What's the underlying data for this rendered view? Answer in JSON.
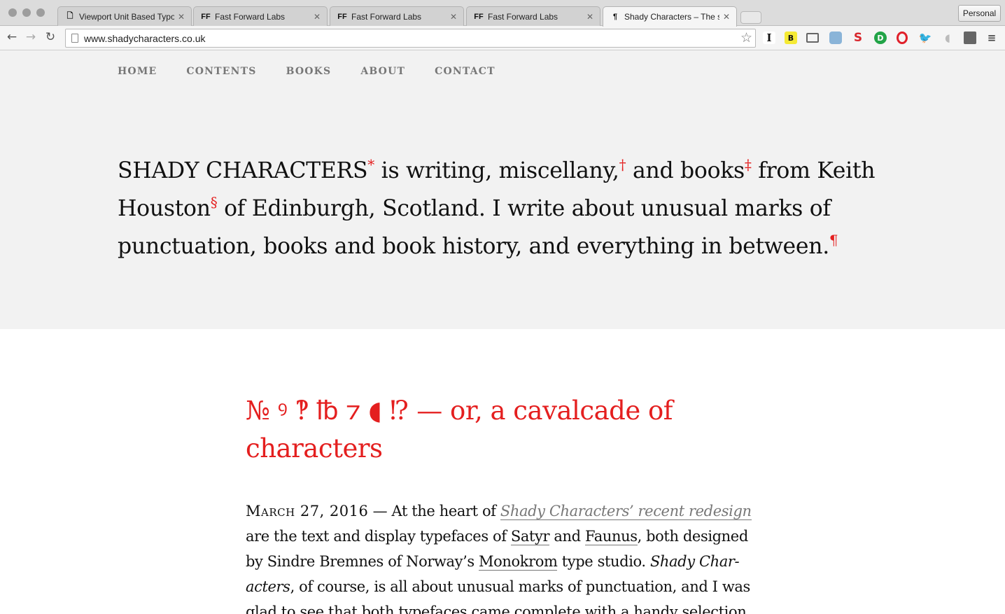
{
  "browser": {
    "tabs": [
      {
        "title": "Viewport Unit Based Typography",
        "icon": "page-icon"
      },
      {
        "title": "Fast Forward Labs",
        "icon": "ff-icon"
      },
      {
        "title": "Fast Forward Labs",
        "icon": "ff-icon"
      },
      {
        "title": "Fast Forward Labs",
        "icon": "ff-icon"
      },
      {
        "title": "Shady Characters – The secret life of punctuation",
        "icon": "pilcrow-icon",
        "active": true
      }
    ],
    "profile_label": "Personal",
    "url": "www.shadycharacters.co.uk",
    "extensions": [
      "instapaper-icon",
      "b-icon",
      "cast-icon",
      "camera-icon",
      "s-icon",
      "d-icon",
      "opera-icon",
      "bird-icon",
      "leaf-icon",
      "puzzle-icon",
      "menu-icon"
    ]
  },
  "site": {
    "nav": [
      "HOME",
      "CONTENTS",
      "BOOKS",
      "ABOUT",
      "CONTACT"
    ],
    "tagline": {
      "part1": "SHADY CHARACTERS",
      "mark1": "*",
      "part2": " is writing, miscellany,",
      "mark2": "†",
      "part3": " and books",
      "mark3": "‡",
      "part4": " from Keith Houston",
      "mark4": "§",
      "part5": " of Edinburgh, Scotland. I write about unusual marks of punc­tuation, books and book history, and everything in between.",
      "mark5": "¶"
    },
    "accent_color": "#e41f1f"
  },
  "post": {
    "title": "№ ꝰ ‽ ℔ ⁊ ◖ ⁉ — or, a cavalcade of characters",
    "date": "March 27, 2016",
    "sep": " — At the heart of ",
    "link1": "Shady Characters’ recent redesign",
    "t1": " are the text and display typefaces of ",
    "link2": "Satyr",
    "t2": " and ",
    "link3": "Faunus",
    "t3": ", both designed by Sindre Bremnes of Norway’s ",
    "link4": "Monokrom",
    "t4": " type studio. ",
    "em1": "Shady Char­acters",
    "t5": ", of course, is all about unusual marks of punctuation, and I was glad to see that both typefaces came complete with a handy selection"
  }
}
